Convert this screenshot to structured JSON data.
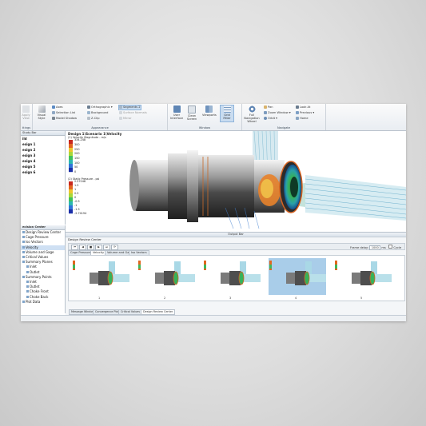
{
  "ribbon": {
    "groups": [
      {
        "title": "ttings"
      },
      {
        "title": "Appearance"
      },
      {
        "title": "Window"
      },
      {
        "title": "Navigate"
      }
    ],
    "apply_view": "Apply View",
    "visual_style": "Visual Style",
    "axes": "Axes",
    "selection_list": "Selection List",
    "model_shadow": "Model Shadow",
    "orthographic": "Orthographic",
    "background": "Background",
    "z_clip": "Z-Clip",
    "segments": "Segments",
    "segments_value": "2",
    "surface_normals": "Surface Normals",
    "mirror": "Mirror",
    "user_interface": "User Interface",
    "clean_screen": "Clean Screen",
    "viewports": "Viewports",
    "grid_fitter": "Grid Fitter",
    "full_nav_wheel": "Full Navigation Wheel",
    "pan": "Pan",
    "zoom_window": "Zoom Window",
    "orbit": "Orbit",
    "look_at": "Look At",
    "previous": "Previous",
    "home": "Home"
  },
  "design_panel": {
    "header": "Study Bar",
    "items": [
      "ild",
      "esign 1",
      "esign 2",
      "esign 3",
      "esign 4",
      "esign 5",
      "esign 6"
    ]
  },
  "decision_panel": {
    "header": "ecision Center",
    "items": [
      {
        "label": "Design Review Center",
        "indent": 0,
        "selected": false
      },
      {
        "label": "Cage Pressure",
        "indent": 0,
        "selected": false
      },
      {
        "label": "Iso Vectors",
        "indent": 0,
        "selected": false
      },
      {
        "label": "Velocity",
        "indent": 0,
        "selected": true
      },
      {
        "label": "Volume and Gage",
        "indent": 0,
        "selected": false
      },
      {
        "label": "Critical Values",
        "indent": 0,
        "selected": false
      },
      {
        "label": "Summary Planes",
        "indent": 0,
        "selected": false
      },
      {
        "label": "Inlet",
        "indent": 1,
        "selected": false
      },
      {
        "label": "Outlet",
        "indent": 1,
        "selected": false
      },
      {
        "label": "Summary Points",
        "indent": 0,
        "selected": false
      },
      {
        "label": "Inlet",
        "indent": 1,
        "selected": false
      },
      {
        "label": "Outlet",
        "indent": 1,
        "selected": false
      },
      {
        "label": "Choke Front",
        "indent": 1,
        "selected": false
      },
      {
        "label": "Choke Back",
        "indent": 1,
        "selected": false
      },
      {
        "label": "Plot Data",
        "indent": 0,
        "selected": false
      }
    ]
  },
  "viewport": {
    "title": "Design 1\\Scenario 1\\Velocity",
    "legend1": {
      "title": "(1) Velocity Magnitude - m/s",
      "values": [
        "334.248",
        "300",
        "250",
        "200",
        "150",
        "100",
        "50",
        "0"
      ],
      "colors": [
        "#c8281e",
        "#e3651f",
        "#ecc62c",
        "#a8d838",
        "#3fc15b",
        "#2bb7b0",
        "#2f74d8",
        "#1b2fa8"
      ]
    },
    "legend2": {
      "title": "(2) Static Pressure - psi",
      "values": [
        "2.57048",
        "1.5",
        "1",
        "0.5",
        "0",
        "-0.5",
        "-1",
        "-1.5",
        "-2.74194"
      ],
      "colors": [
        "#c8281e",
        "#e3651f",
        "#ecc62c",
        "#a8d838",
        "#3fc15b",
        "#2bb7b0",
        "#2f74d8",
        "#1b2fa8"
      ]
    }
  },
  "output": {
    "title": "Output Bar",
    "drc_label": "Design Review Center",
    "transport": [
      "⏮",
      "◀",
      "■",
      "▶",
      "⏭",
      "⟳"
    ],
    "frame_delay_label": "Frame delay:",
    "frame_delay_value": "1000",
    "frame_delay_unit": "ms",
    "cycle_label": "Cycle",
    "tabs": [
      "Cage Pressure",
      "Velocity",
      "Volume and Gage",
      "Iso Vectors"
    ],
    "active_tab": 1,
    "thumbnails": [
      {
        "num": "1",
        "selected": false
      },
      {
        "num": "2",
        "selected": false
      },
      {
        "num": "3",
        "selected": false
      },
      {
        "num": "4",
        "selected": true
      },
      {
        "num": "5",
        "selected": false
      }
    ]
  },
  "bottom_tabs": [
    "Message Window",
    "Convergence Plot",
    "Critical Values",
    "Design Review Center"
  ],
  "bottom_active": 3
}
